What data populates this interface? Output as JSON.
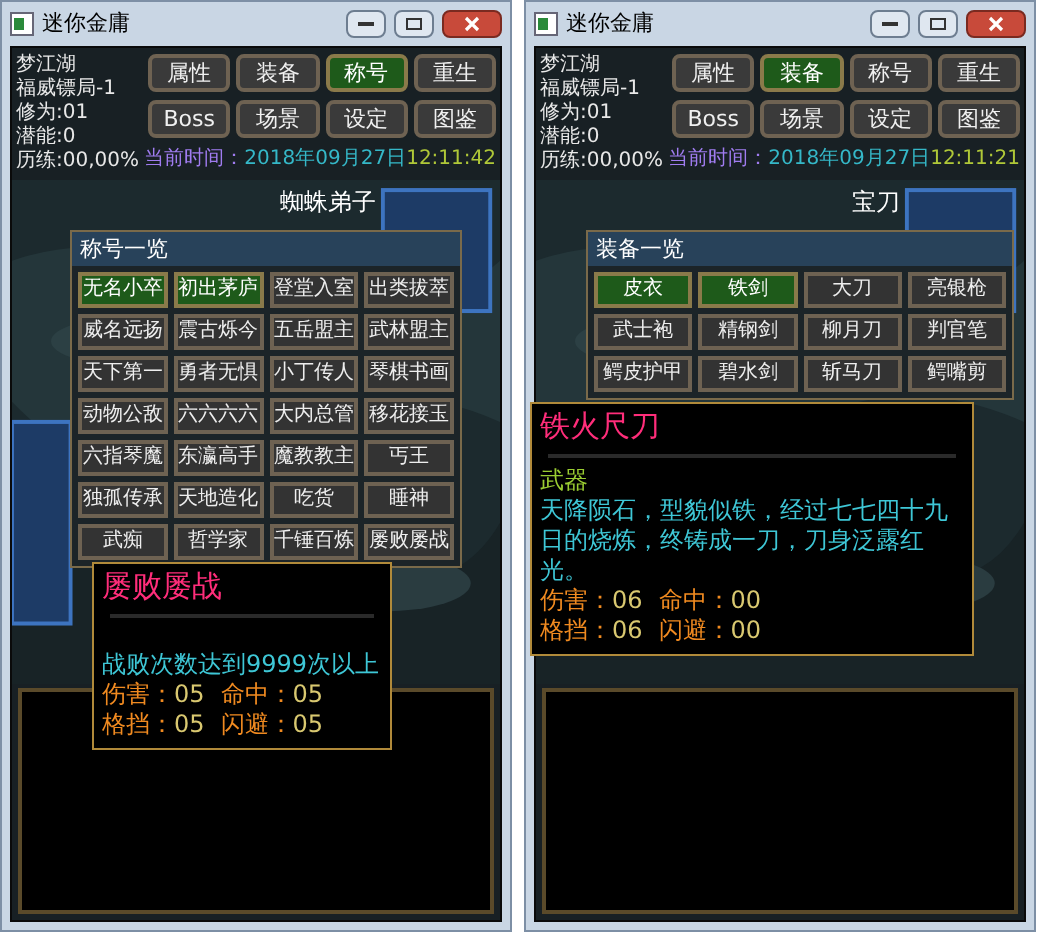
{
  "windows": [
    {
      "title": "迷你金庸",
      "stats": [
        "梦江湖",
        "福威镖局-1",
        "修为:01",
        "潜能:0",
        "历练:00,00%"
      ],
      "menu": [
        {
          "label": "属性",
          "selected": false
        },
        {
          "label": "装备",
          "selected": false
        },
        {
          "label": "称号",
          "selected": true
        },
        {
          "label": "重生",
          "selected": false
        },
        {
          "label": "Boss",
          "selected": false
        },
        {
          "label": "场景",
          "selected": false
        },
        {
          "label": "设定",
          "selected": false
        },
        {
          "label": "图鉴",
          "selected": false
        }
      ],
      "time_label": "当前时间：",
      "date": "2018年09月27日",
      "time": "12:11:42",
      "scene_name": "蜘蛛弟子",
      "panel": {
        "title": "称号一览",
        "items": [
          {
            "label": "无名小卒",
            "selected": true
          },
          {
            "label": "初出茅庐",
            "selected": true
          },
          {
            "label": "登堂入室",
            "selected": false
          },
          {
            "label": "出类拔萃",
            "selected": false
          },
          {
            "label": "威名远扬",
            "selected": false
          },
          {
            "label": "震古烁今",
            "selected": false
          },
          {
            "label": "五岳盟主",
            "selected": false
          },
          {
            "label": "武林盟主",
            "selected": false
          },
          {
            "label": "天下第一",
            "selected": false
          },
          {
            "label": "勇者无惧",
            "selected": false
          },
          {
            "label": "小丁传人",
            "selected": false
          },
          {
            "label": "琴棋书画",
            "selected": false
          },
          {
            "label": "动物公敌",
            "selected": false
          },
          {
            "label": "六六六六",
            "selected": false
          },
          {
            "label": "大内总管",
            "selected": false
          },
          {
            "label": "移花接玉",
            "selected": false
          },
          {
            "label": "六指琴魔",
            "selected": false
          },
          {
            "label": "东瀛高手",
            "selected": false
          },
          {
            "label": "魔教教主",
            "selected": false
          },
          {
            "label": "丐王",
            "selected": false
          },
          {
            "label": "独孤传承",
            "selected": false
          },
          {
            "label": "天地造化",
            "selected": false
          },
          {
            "label": "吃货",
            "selected": false
          },
          {
            "label": "睡神",
            "selected": false
          },
          {
            "label": "武痴",
            "selected": false
          },
          {
            "label": "哲学家",
            "selected": false
          },
          {
            "label": "千锤百炼",
            "selected": false
          },
          {
            "label": "屡败屡战",
            "selected": false
          }
        ]
      },
      "tooltip": {
        "title": "屡败屡战",
        "description": "战败次数达到9999次以上",
        "stats": [
          {
            "label": "伤害：",
            "value": "05"
          },
          {
            "label": "命中：",
            "value": "05"
          },
          {
            "label": "格挡：",
            "value": "05"
          },
          {
            "label": "闪避：",
            "value": "05"
          }
        ]
      }
    },
    {
      "title": "迷你金庸",
      "stats": [
        "梦江湖",
        "福威镖局-1",
        "修为:01",
        "潜能:0",
        "历练:00,00%"
      ],
      "menu": [
        {
          "label": "属性",
          "selected": false
        },
        {
          "label": "装备",
          "selected": true
        },
        {
          "label": "称号",
          "selected": false
        },
        {
          "label": "重生",
          "selected": false
        },
        {
          "label": "Boss",
          "selected": false
        },
        {
          "label": "场景",
          "selected": false
        },
        {
          "label": "设定",
          "selected": false
        },
        {
          "label": "图鉴",
          "selected": false
        }
      ],
      "time_label": "当前时间：",
      "date": "2018年09月27日",
      "time": "12:11:21",
      "scene_name": "宝刀",
      "panel": {
        "title": "装备一览",
        "items": [
          {
            "label": "皮衣",
            "selected": true
          },
          {
            "label": "铁剑",
            "selected": true
          },
          {
            "label": "大刀",
            "selected": false
          },
          {
            "label": "亮银枪",
            "selected": false
          },
          {
            "label": "武士袍",
            "selected": false
          },
          {
            "label": "精钢剑",
            "selected": false
          },
          {
            "label": "柳月刀",
            "selected": false
          },
          {
            "label": "判官笔",
            "selected": false
          },
          {
            "label": "鳄皮护甲",
            "selected": false
          },
          {
            "label": "碧水剑",
            "selected": false
          },
          {
            "label": "斩马刀",
            "selected": false
          },
          {
            "label": "鳄嘴剪",
            "selected": false
          }
        ]
      },
      "tooltip": {
        "title": "铁火尺刀",
        "category": "武器",
        "description": "天降陨石，型貌似铁，经过七七四十九日的烧炼，终铸成一刀，刀身泛露红光。",
        "stats": [
          {
            "label": "伤害：",
            "value": "06"
          },
          {
            "label": "命中：",
            "value": "00"
          },
          {
            "label": "格挡：",
            "value": "06"
          },
          {
            "label": "闪避：",
            "value": "00"
          }
        ]
      }
    }
  ]
}
